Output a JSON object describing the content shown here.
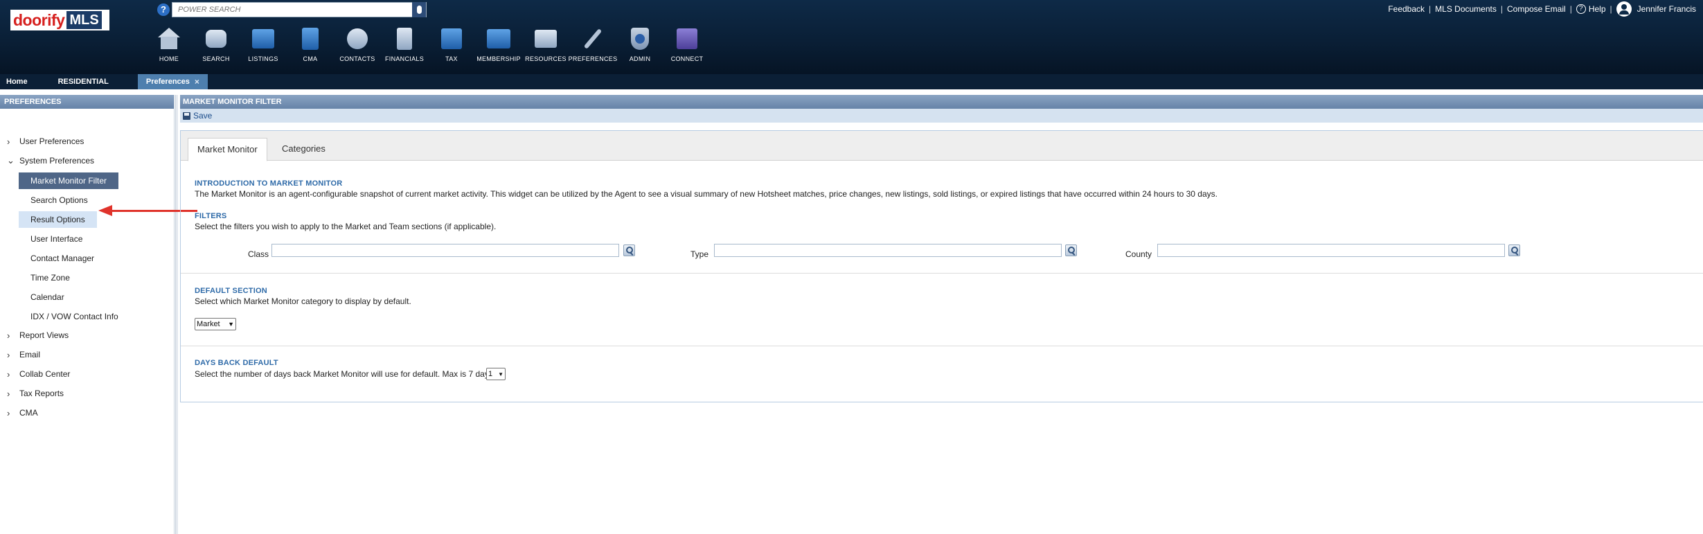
{
  "header": {
    "logo": {
      "brand": "doorify",
      "suffix": "MLS"
    },
    "search_placeholder": "POWER SEARCH",
    "top_links": [
      "Feedback",
      "MLS Documents",
      "Compose Email",
      "Help"
    ],
    "user_name": "Jennifer Francis",
    "nav": [
      {
        "label": "HOME",
        "icon": "home-icon"
      },
      {
        "label": "SEARCH",
        "icon": "binoculars-icon"
      },
      {
        "label": "LISTINGS",
        "icon": "listings-icon"
      },
      {
        "label": "CMA",
        "icon": "clipboard-icon"
      },
      {
        "label": "CONTACTS",
        "icon": "contacts-icon"
      },
      {
        "label": "FINANCIALS",
        "icon": "calculator-icon"
      },
      {
        "label": "TAX",
        "icon": "tax-icon"
      },
      {
        "label": "MEMBERSHIP",
        "icon": "briefcase-icon"
      },
      {
        "label": "RESOURCES",
        "icon": "folder-icon"
      },
      {
        "label": "PREFERENCES",
        "icon": "wrench-icon"
      },
      {
        "label": "ADMIN",
        "icon": "shield-icon"
      },
      {
        "label": "CONNECT",
        "icon": "connect-icon"
      }
    ]
  },
  "tabs": {
    "home": "Home",
    "residential": "RESIDENTIAL",
    "preferences": "Preferences",
    "close": "×"
  },
  "sidebar": {
    "title": "PREFERENCES",
    "groups": [
      {
        "label": "User Preferences",
        "chevron": "›"
      },
      {
        "label": "System Preferences",
        "chevron": "⌄"
      }
    ],
    "system_items": [
      "Market Monitor Filter",
      "Search Options",
      "Result Options",
      "User Interface",
      "Contact Manager",
      "Time Zone",
      "Calendar",
      "IDX / VOW Contact Info"
    ],
    "more_groups": [
      "Report Views",
      "Email",
      "Collab Center",
      "Tax Reports",
      "CMA"
    ]
  },
  "main": {
    "title": "MARKET MONITOR FILTER",
    "save_label": "Save",
    "tabs": [
      "Market Monitor",
      "Categories"
    ],
    "intro_title": "INTRODUCTION TO MARKET MONITOR",
    "intro_text": "The Market Monitor is an agent-configurable snapshot of current market activity. This widget can be utilized by the Agent to see a visual summary of new Hotsheet matches, price changes, new listings, sold listings, or expired listings that have occurred within 24 hours to 30 days.",
    "filters_title": "FILTERS",
    "filters_text": "Select the filters you wish to apply to the Market and Team sections (if applicable).",
    "filter_labels": [
      "Class",
      "Type",
      "County"
    ],
    "default_title": "DEFAULT SECTION",
    "default_text": "Select which Market Monitor category to display by default.",
    "default_value": "Market",
    "days_title": "DAYS BACK DEFAULT",
    "days_text": "Select the number of days back Market Monitor will use for default. Max is 7 days.",
    "days_value": "1"
  },
  "colors": {
    "header": "#0e2a47",
    "accent": "#2e6aa8",
    "selected": "#4f6687",
    "arrow": "#e0332b"
  }
}
